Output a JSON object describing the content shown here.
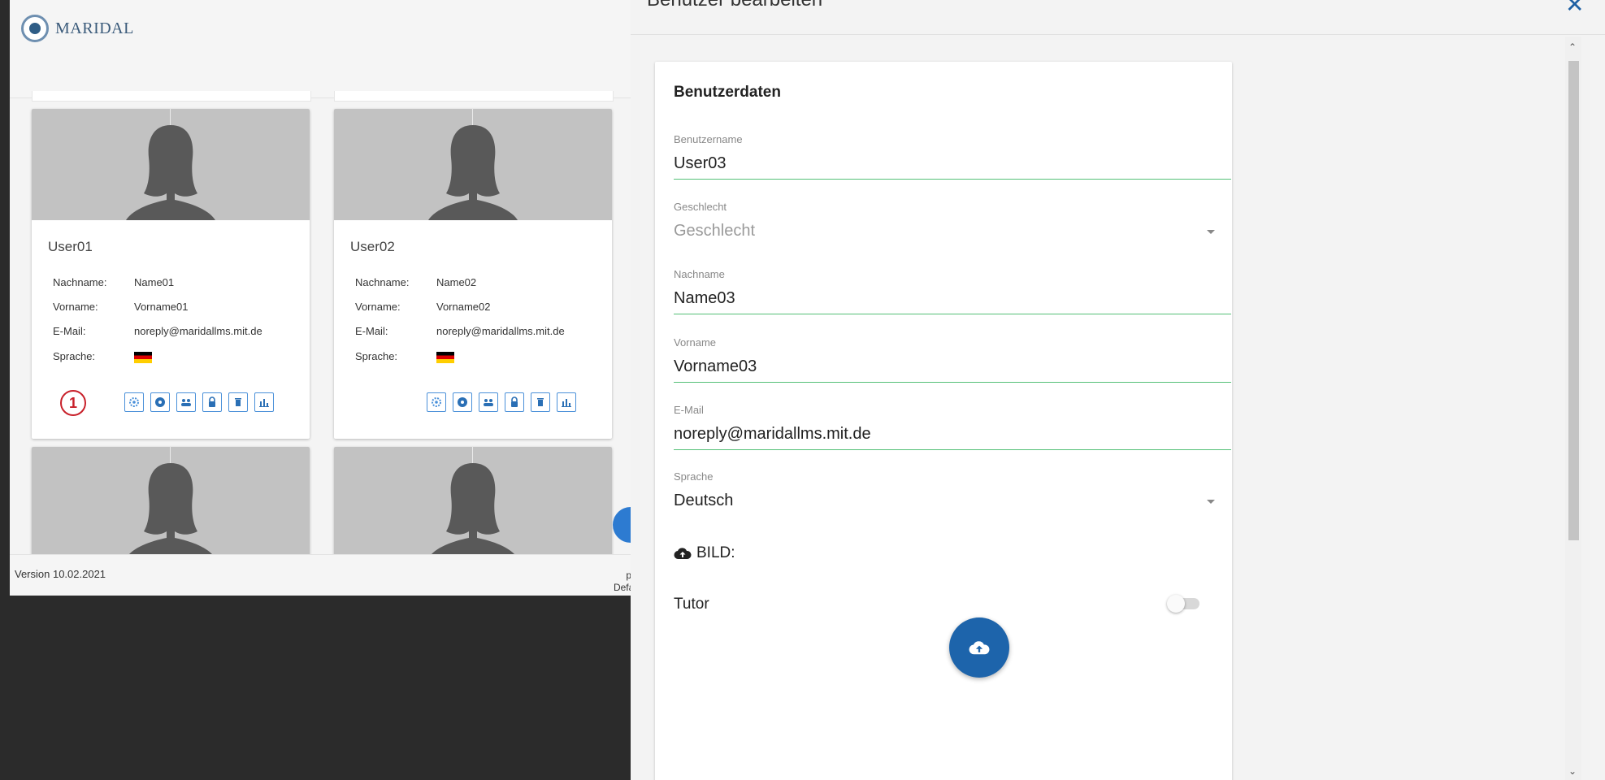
{
  "app": {
    "logo_text": "MARIDAL",
    "users": [
      {
        "username": "User01",
        "fields": [
          {
            "label": "Nachname:",
            "value": "Name01"
          },
          {
            "label": "Vorname:",
            "value": "Vorname01"
          },
          {
            "label": "E-Mail:",
            "value": "noreply@maridallms.mit.de"
          }
        ],
        "language_label": "Sprache:",
        "language_flag": "german-flag-icon"
      },
      {
        "username": "User02",
        "fields": [
          {
            "label": "Nachname:",
            "value": "Name02"
          },
          {
            "label": "Vorname:",
            "value": "Vorname02"
          },
          {
            "label": "E-Mail:",
            "value": "noreply@maridallms.mit.de"
          }
        ],
        "language_label": "Sprache:",
        "language_flag": "german-flag-icon"
      }
    ],
    "action_icons": [
      "settings-icon",
      "role-icon",
      "group-icon",
      "lock-icon",
      "delete-icon",
      "statistics-icon"
    ],
    "marker_label": "1",
    "footer": {
      "version": "Version 10.02.2021",
      "right_line1": "p.p",
      "right_line2": "Defau"
    }
  },
  "dialog": {
    "title": "Benutzer bearbeiten",
    "close_label": "✕",
    "section_title": "Benutzerdaten",
    "fields": [
      {
        "label": "Benutzername",
        "value": "User03"
      },
      {
        "label": "Geschlecht",
        "value": "Geschlecht"
      },
      {
        "label": "Nachname",
        "value": "Name03"
      },
      {
        "label": "Vorname",
        "value": "Vorname03"
      },
      {
        "label": "E-Mail",
        "value": "noreply@maridallms.mit.de"
      },
      {
        "label": "Sprache",
        "value": "Deutsch"
      }
    ],
    "bild_label": "BILD:",
    "tutor_label": "Tutor",
    "tutor_enabled": false
  },
  "colors": {
    "accent_blue": "#1d64ab",
    "field_underline": "#55c077",
    "marker_red": "#c8202a"
  }
}
